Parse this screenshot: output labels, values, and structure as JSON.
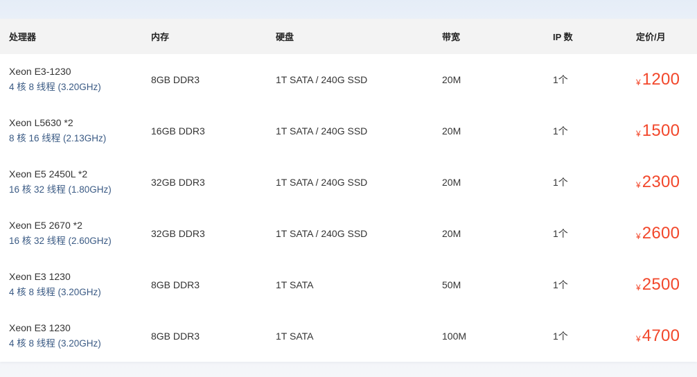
{
  "table": {
    "headers": {
      "cpu": "处理器",
      "memory": "内存",
      "disk": "硬盘",
      "bandwidth": "带宽",
      "ip_count": "IP 数",
      "price": "定价/月"
    },
    "currency_symbol": "¥",
    "accent_color": "#f2472b",
    "rows": [
      {
        "cpu_name": "Xeon E3-1230",
        "cpu_spec": "4 核 8 线程 (3.20GHz)",
        "memory": "8GB DDR3",
        "disk": "1T SATA / 240G SSD",
        "bandwidth": "20M",
        "ip": "1个",
        "price": "1200"
      },
      {
        "cpu_name": "Xeon L5630 *2",
        "cpu_spec": "8 核 16 线程 (2.13GHz)",
        "memory": "16GB DDR3",
        "disk": "1T SATA / 240G SSD",
        "bandwidth": "20M",
        "ip": "1个",
        "price": "1500"
      },
      {
        "cpu_name": "Xeon E5 2450L *2",
        "cpu_spec": "16 核 32 线程 (1.80GHz)",
        "memory": "32GB DDR3",
        "disk": "1T SATA / 240G SSD",
        "bandwidth": "20M",
        "ip": "1个",
        "price": "2300"
      },
      {
        "cpu_name": "Xeon E5 2670 *2",
        "cpu_spec": "16 核 32 线程 (2.60GHz)",
        "memory": "32GB DDR3",
        "disk": "1T SATA / 240G SSD",
        "bandwidth": "20M",
        "ip": "1个",
        "price": "2600"
      },
      {
        "cpu_name": "Xeon E3 1230",
        "cpu_spec": "4 核 8 线程 (3.20GHz)",
        "memory": "8GB DDR3",
        "disk": "1T SATA",
        "bandwidth": "50M",
        "ip": "1个",
        "price": "2500"
      },
      {
        "cpu_name": "Xeon E3 1230",
        "cpu_spec": "4 核 8 线程 (3.20GHz)",
        "memory": "8GB DDR3",
        "disk": "1T SATA",
        "bandwidth": "100M",
        "ip": "1个",
        "price": "4700"
      }
    ]
  }
}
